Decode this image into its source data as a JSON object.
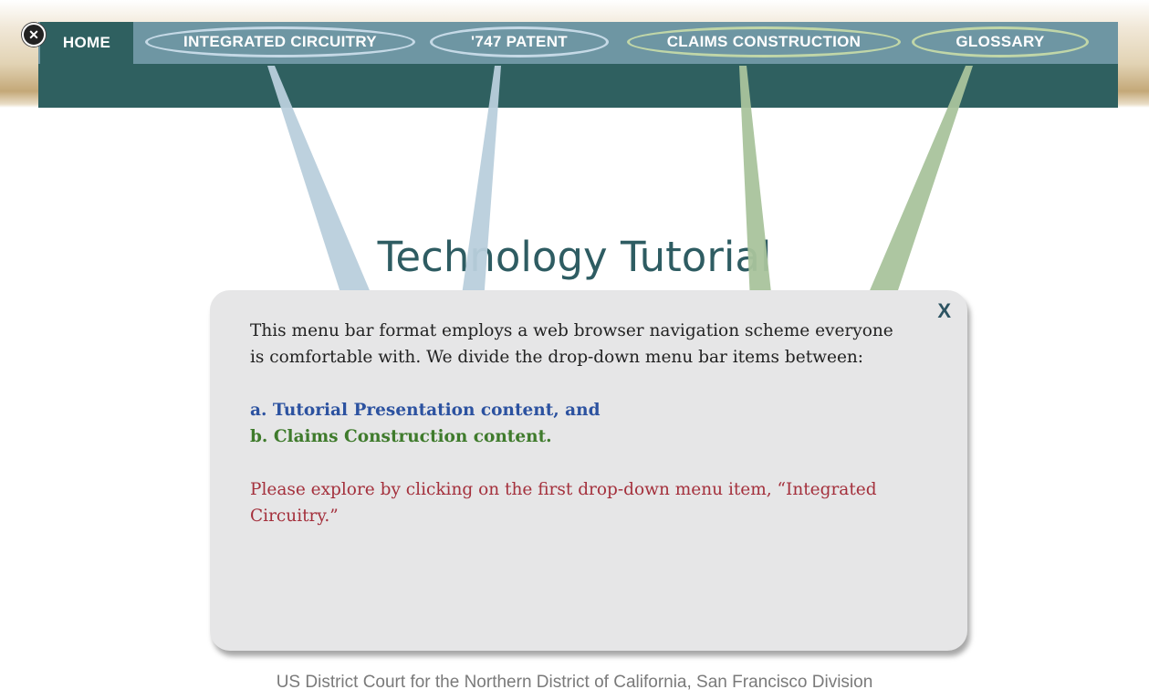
{
  "nav": {
    "home": "HOME",
    "integrated_circuitry": "INTEGRATED CIRCUITRY",
    "patent": "'747 PATENT",
    "claims_construction": "CLAIMS CONSTRUCTION",
    "glossary": "GLOSSARY",
    "close_glyph": "✕"
  },
  "page": {
    "title": "Technology Tutorial"
  },
  "popup": {
    "close": "X",
    "intro": "This menu bar format employs a web browser navigation scheme everyone is comfortable with. We divide the drop-down menu bar items between:",
    "item_a": "a. Tutorial Presentation content, and",
    "item_b": "b. Claims Construction content.",
    "instruction": "Please explore by clicking on the first drop-down menu item, “Integrated Circuitry.”"
  },
  "footer": {
    "text": "US District Court for the Northern District of California, San Francisco Division"
  },
  "colors": {
    "nav_dark": "#2f6060",
    "nav_strip": "#6e96a3",
    "beam_blue": "#b9cfdc",
    "beam_green": "#a9c39c",
    "item_a_blue": "#2c52a0",
    "item_b_green": "#3f7b2c",
    "instruction_red": "#a4303c"
  }
}
